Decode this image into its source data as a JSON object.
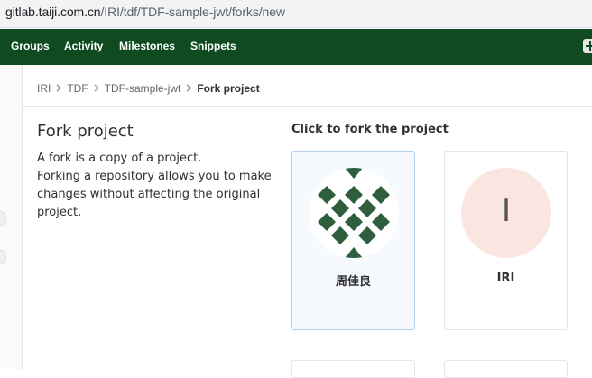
{
  "browser": {
    "url_host": "gitlab.taiji.com.cn",
    "url_path": "/IRI/tdf/TDF-sample-jwt/forks/new"
  },
  "nav": {
    "items": [
      "Groups",
      "Activity",
      "Milestones",
      "Snippets"
    ]
  },
  "breadcrumb": {
    "items": [
      "IRI",
      "TDF",
      "TDF-sample-jwt"
    ],
    "current": "Fork project"
  },
  "main": {
    "title": "Fork project",
    "description": "A fork is a copy of a project.\nForking a repository allows you to make changes without affecting the original project.",
    "section_title": "Click to fork the project"
  },
  "namespaces": [
    {
      "name": "周佳良",
      "avatar_type": "identicon",
      "avatar_color": "#2f5e3c",
      "selected": true
    },
    {
      "name": "IRI",
      "avatar_type": "letter",
      "avatar_letter": "I",
      "avatar_color": "#fbe5e1",
      "selected": false
    }
  ],
  "colors": {
    "navbar": "#0f4a21",
    "selected_card_bg": "#f6f9fd"
  }
}
